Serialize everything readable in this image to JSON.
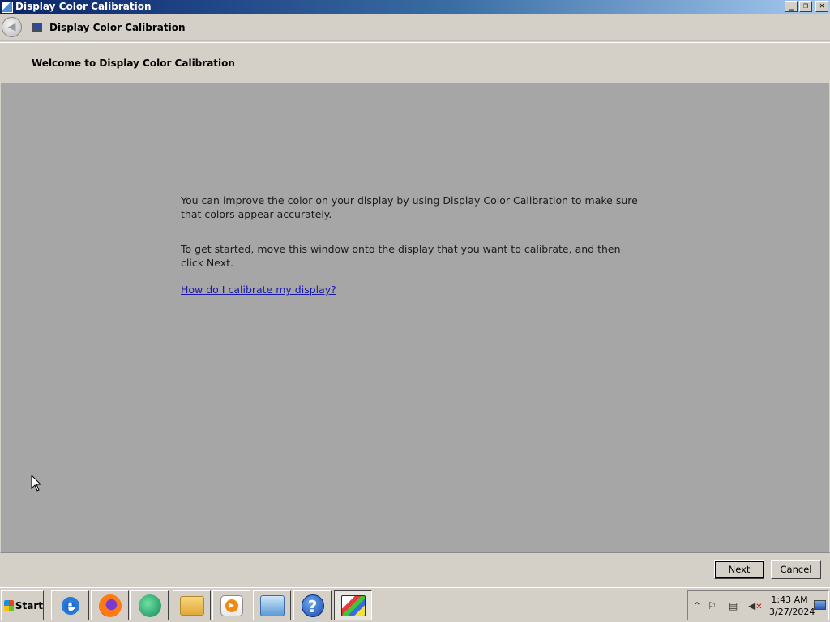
{
  "window": {
    "title": "Display Color Calibration",
    "buttons": {
      "minimize": "_",
      "restore": "❐",
      "close": "✕"
    }
  },
  "nav": {
    "title": "Display Color Calibration",
    "back_icon": "back-arrow-icon"
  },
  "header": {
    "title": "Welcome to Display Color Calibration"
  },
  "content": {
    "paragraph1": "You can improve the color on your display by using Display Color Calibration to make sure that colors appear accurately.",
    "paragraph2": "To get started, move this window onto the display that you want to calibrate, and then click Next.",
    "help_link": "How do I calibrate my display?"
  },
  "buttons": {
    "next": "Next",
    "cancel": "Cancel"
  },
  "taskbar": {
    "start_label": "Start",
    "apps": [
      {
        "name": "internet-explorer-icon"
      },
      {
        "name": "firefox-icon"
      },
      {
        "name": "messenger-icon"
      },
      {
        "name": "file-explorer-icon"
      },
      {
        "name": "media-player-icon"
      },
      {
        "name": "control-panel-icon"
      },
      {
        "name": "help-icon"
      },
      {
        "name": "display-calibration-icon"
      }
    ],
    "clock": {
      "time": "1:43 AM",
      "date": "3/27/2024"
    }
  },
  "colors": {
    "content_bg": "#a6a6a6",
    "chrome_bg": "#d4d0c8",
    "link": "#1a1aa6",
    "titlebar_start": "#0a246a"
  }
}
